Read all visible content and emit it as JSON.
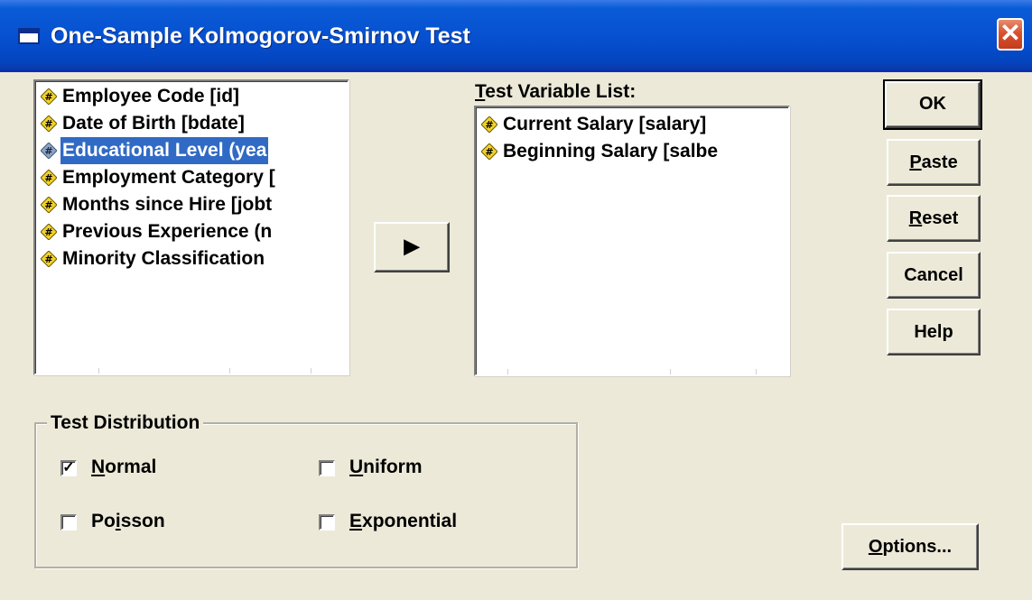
{
  "window": {
    "title": "One-Sample Kolmogorov-Smirnov Test",
    "close_glyph": "✕"
  },
  "source_list": {
    "items": [
      {
        "label": "Employee Code [id]"
      },
      {
        "label": "Date of Birth [bdate]"
      },
      {
        "label": "Educational Level (yea",
        "selected": true
      },
      {
        "label": "Employment Category ["
      },
      {
        "label": "Months since Hire [jobt"
      },
      {
        "label": "Previous Experience (n"
      },
      {
        "label": "Minority Classification"
      }
    ]
  },
  "move_button": {
    "glyph": "▶"
  },
  "test_variables": {
    "label_pre": "",
    "label_key": "T",
    "label_post": "est Variable List:",
    "items": [
      {
        "label": "Current Salary [salary]"
      },
      {
        "label": "Beginning Salary [salbe"
      }
    ]
  },
  "buttons": {
    "ok": {
      "label": "OK"
    },
    "paste": {
      "key": "P",
      "rest": "aste"
    },
    "reset": {
      "key": "R",
      "rest": "eset"
    },
    "cancel": {
      "label": "Cancel"
    },
    "help": {
      "label": "Help"
    },
    "options": {
      "key": "O",
      "rest": "ptions..."
    }
  },
  "test_distribution": {
    "title": "Test Distribution",
    "normal": {
      "key": "N",
      "rest": "ormal",
      "checked": true,
      "mark": "✓"
    },
    "uniform": {
      "key": "U",
      "rest": "niform",
      "checked": false
    },
    "poisson": {
      "pre": "Po",
      "key": "i",
      "rest": "sson",
      "checked": false
    },
    "exponential": {
      "key": "E",
      "rest": "xponential",
      "checked": false
    }
  },
  "icons": {
    "variable": "scale-variable-icon",
    "selected_color": "#316ac5"
  }
}
